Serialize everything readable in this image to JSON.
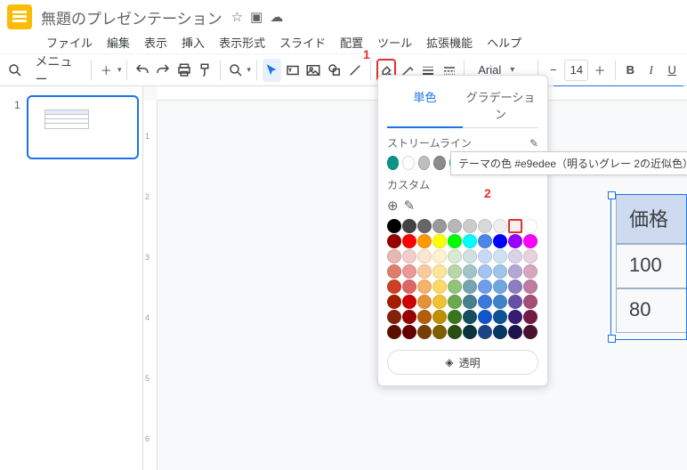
{
  "header": {
    "doc_title": "無題のプレゼンテーション",
    "menu": [
      "ファイル",
      "編集",
      "表示",
      "挿入",
      "表示形式",
      "スライド",
      "配置",
      "ツール",
      "拡張機能",
      "ヘルプ"
    ]
  },
  "toolbar": {
    "menu_btn": "メニュー",
    "font_name": "Arial",
    "font_size": "14"
  },
  "popover": {
    "tab_solid": "単色",
    "tab_gradient": "グラデーション",
    "section_streamline": "ストリームライン",
    "section_custom": "カスタム",
    "transparent": "透明",
    "streamline_colors": [
      "#0b9488",
      "#ffffff",
      "#bfbfbf",
      "#8c8c8c",
      "#4da3d1",
      "#2170b8",
      "#f4511e",
      "#0b3a6b",
      "#1b3f73",
      "#f5c1c0"
    ],
    "grid_colors": [
      "#000000",
      "#434343",
      "#666666",
      "#999999",
      "#b7b7b7",
      "#cccccc",
      "#d9d9d9",
      "#efefef",
      "#f3f3f3",
      "#ffffff",
      "#980000",
      "#ff0000",
      "#ff9900",
      "#ffff00",
      "#00ff00",
      "#00ffff",
      "#4a86e8",
      "#0000ff",
      "#9900ff",
      "#ff00ff",
      "#e6b8af",
      "#f4cccc",
      "#fce5cd",
      "#fff2cc",
      "#d9ead3",
      "#d0e0e3",
      "#c9daf8",
      "#cfe2f3",
      "#d9d2e9",
      "#ead1dc",
      "#dd7e6b",
      "#ea9999",
      "#f9cb9c",
      "#ffe599",
      "#b6d7a8",
      "#a2c4c9",
      "#a4c2f4",
      "#9fc5e8",
      "#b4a7d6",
      "#d5a6bd",
      "#cc4125",
      "#e06666",
      "#f6b26b",
      "#ffd966",
      "#93c47d",
      "#76a5af",
      "#6d9eeb",
      "#6fa8dc",
      "#8e7cc3",
      "#c27ba0",
      "#a61c00",
      "#cc0000",
      "#e69138",
      "#f1c232",
      "#6aa84f",
      "#45818e",
      "#3c78d8",
      "#3d85c6",
      "#674ea7",
      "#a64d79",
      "#85200c",
      "#990000",
      "#b45f06",
      "#bf9000",
      "#38761d",
      "#134f5c",
      "#1155cc",
      "#0b5394",
      "#351c75",
      "#741b47",
      "#5b0f00",
      "#660000",
      "#783f04",
      "#7f6000",
      "#274e13",
      "#0c343d",
      "#1c4587",
      "#073763",
      "#20124d",
      "#4c1130"
    ],
    "selected_index": 8
  },
  "tooltip": {
    "text": "テーマの色 #e9edee（明るいグレー 2の近似色）"
  },
  "slide_table": {
    "header": "価格",
    "rows": [
      "100",
      "80"
    ]
  },
  "sidebar": {
    "slide_number": "1"
  },
  "annotations": {
    "one": "1",
    "two": "2"
  }
}
